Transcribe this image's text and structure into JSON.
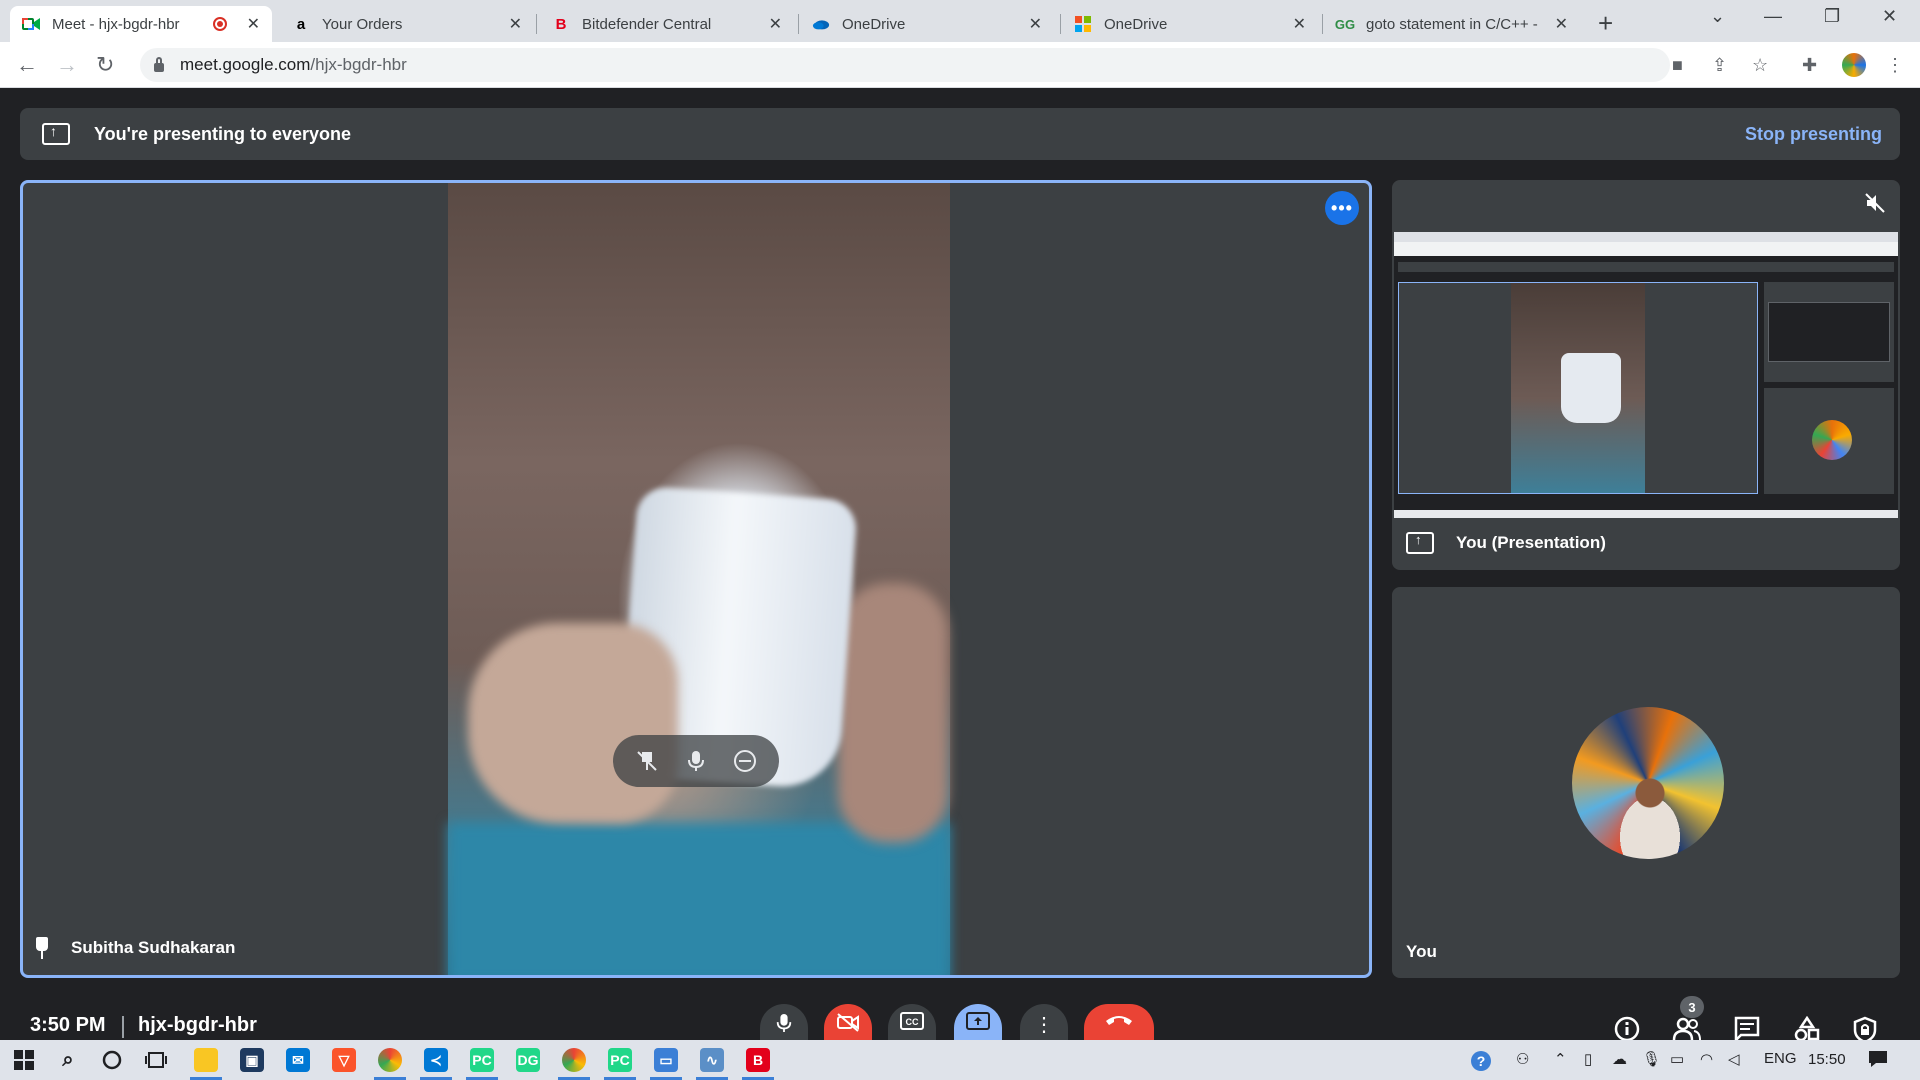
{
  "browser": {
    "tabs": [
      {
        "title": "Meet - hjx-bgdr-hbr",
        "active": true,
        "recording": true,
        "favicon": "google-meet-icon"
      },
      {
        "title": "Your Orders",
        "active": false,
        "favicon": "amazon-icon"
      },
      {
        "title": "Bitdefender Central",
        "active": false,
        "favicon": "bitdefender-icon"
      },
      {
        "title": "OneDrive",
        "active": false,
        "favicon": "onedrive-icon"
      },
      {
        "title": "OneDrive",
        "active": false,
        "favicon": "microsoft-icon"
      },
      {
        "title": "goto statement in C/C++ -",
        "active": false,
        "favicon": "geeksforgeeks-icon"
      }
    ],
    "url_host": "meet.google.com",
    "url_path": "/hjx-bgdr-hbr"
  },
  "banner": {
    "text": "You're presenting to everyone",
    "stop_label": "Stop presenting"
  },
  "main_tile": {
    "participant_name": "Subitha Sudhakaran"
  },
  "side_tiles": {
    "presentation_label": "You (Presentation)",
    "self_label": "You"
  },
  "meetbar": {
    "time": "3:50 PM",
    "meeting_code": "hjx-bgdr-hbr",
    "participant_count": "3"
  },
  "taskbar": {
    "language": "ENG",
    "time": "15:50"
  },
  "colors": {
    "accent_blue": "#8ab4f8",
    "hangup_red": "#ea4335",
    "tile_bg": "#3c4043",
    "page_bg": "#202124"
  }
}
